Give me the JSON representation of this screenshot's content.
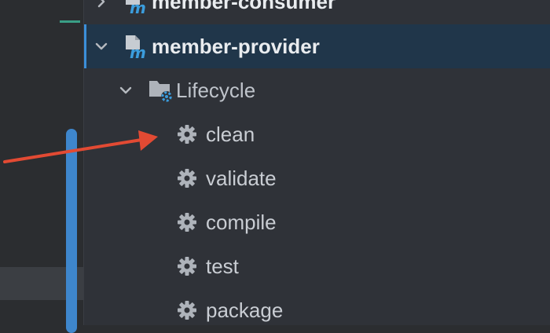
{
  "tree": {
    "modules": [
      {
        "label": "member-consumer"
      },
      {
        "label": "member-provider",
        "selected": true
      }
    ],
    "lifecycle_label": "Lifecycle",
    "phases": [
      "clean",
      "validate",
      "compile",
      "test",
      "package"
    ]
  },
  "icons": [
    "chevron-down-icon",
    "chevron-right-icon",
    "maven-module-icon",
    "lifecycle-folder-icon",
    "gear-icon"
  ],
  "colors": {
    "selection": "#20364a",
    "selection_border": "#3b8fd9",
    "arrow": "#e24a33",
    "maven_blue": "#3b9ddd"
  }
}
